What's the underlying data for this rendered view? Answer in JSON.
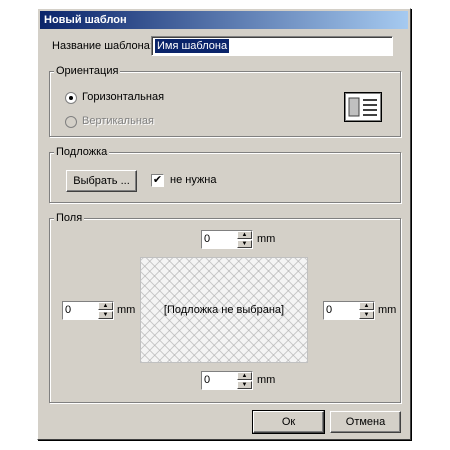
{
  "window": {
    "title": "Новый шаблон"
  },
  "template_name": {
    "label": "Название шаблона:",
    "value": "Имя шаблона"
  },
  "orientation": {
    "legend": "Ориентация",
    "options": [
      {
        "label": "Горизонтальная",
        "selected": true,
        "enabled": true
      },
      {
        "label": "Вертикальная",
        "selected": false,
        "enabled": false
      }
    ],
    "icon": "landscape-page-icon"
  },
  "background": {
    "legend": "Подложка",
    "choose_label": "Выбрать ...",
    "not_needed_label": "не нужна",
    "not_needed_checked": true
  },
  "margins": {
    "legend": "Поля",
    "top": "0",
    "left": "0",
    "right": "0",
    "bottom": "0",
    "unit": "mm",
    "preview_text": "[Подложка не выбрана]"
  },
  "buttons": {
    "ok": "Ок",
    "cancel": "Отмена"
  },
  "colors": {
    "face": "#d4d0c8",
    "title_start": "#0a246a",
    "title_end": "#a6caf0",
    "selection": "#0a246a"
  }
}
